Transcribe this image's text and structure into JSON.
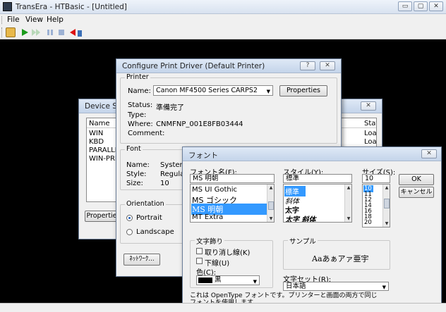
{
  "app": {
    "title": "TransEra - HTBasic - [Untitled]",
    "menu": [
      "File",
      "View",
      "Help"
    ],
    "window_buttons": [
      "▭",
      "▢",
      "✕"
    ]
  },
  "device_setup": {
    "title": "Device Set",
    "col_name": "Name",
    "col_status": "Status",
    "rows": [
      {
        "name": "WIN",
        "status": "Loaded"
      },
      {
        "name": "KBD",
        "status": "Loaded"
      },
      {
        "name": "PARALLE",
        "status": ""
      },
      {
        "name": "WIN-PRN",
        "status": ""
      }
    ],
    "properties_button": "Propertie"
  },
  "print_driver": {
    "title": "Configure Print Driver  (Default Printer)",
    "printer_group": "Printer",
    "name_label": "Name:",
    "name_value": "Canon MF4500 Series CARPS2",
    "properties_button": "Properties",
    "status_label": "Status:",
    "status_value": "準備完了",
    "type_label": "Type:",
    "type_value": "",
    "where_label": "Where:",
    "where_value": "CNMFNP_001E8FB03444",
    "comment_label": "Comment:",
    "comment_value": "",
    "font_group": "Font",
    "font_name_label": "Name:",
    "font_name_value": "System",
    "font_style_label": "Style:",
    "font_style_value": "Regular",
    "font_size_label": "Size:",
    "font_size_value": "10",
    "orientation_group": "Orientation",
    "portrait": "Portrait",
    "landscape": "Landscape",
    "orientation_selected": "Portrait",
    "network_button": "ﾈｯﾄﾜｰｸ..."
  },
  "font_dialog": {
    "title": "フォント",
    "font_name_label": "フォント名(F):",
    "font_name_value": "MS 明朝",
    "font_list": [
      "MS UI Gothic",
      "MS ゴシック",
      "MS 明朝",
      "MT Extra"
    ],
    "font_selected": "MS 明朝",
    "style_label": "スタイル(Y):",
    "style_value": "標準",
    "style_list": [
      "標準",
      "斜体",
      "太字",
      "太字 斜体"
    ],
    "style_selected": "標準",
    "size_label": "サイズ(S):",
    "size_value": "10",
    "size_list": [
      "10",
      "11",
      "12",
      "14",
      "16",
      "18",
      "20"
    ],
    "size_selected": "10",
    "ok_button": "OK",
    "cancel_button": "キャンセル",
    "effects_label": "文字飾り",
    "strikeout_label": "取り消し線(K)",
    "underline_label": "下線(U)",
    "color_label": "色(C):",
    "color_value": "黒",
    "sample_label": "サンプル",
    "sample_text": "Aaあぁアァ亜宇",
    "charset_label": "文字セット(R):",
    "charset_value": "日本語",
    "note": "これは OpenType フォントです。プリンターと画面の両方で同じフォントを使用します。"
  }
}
